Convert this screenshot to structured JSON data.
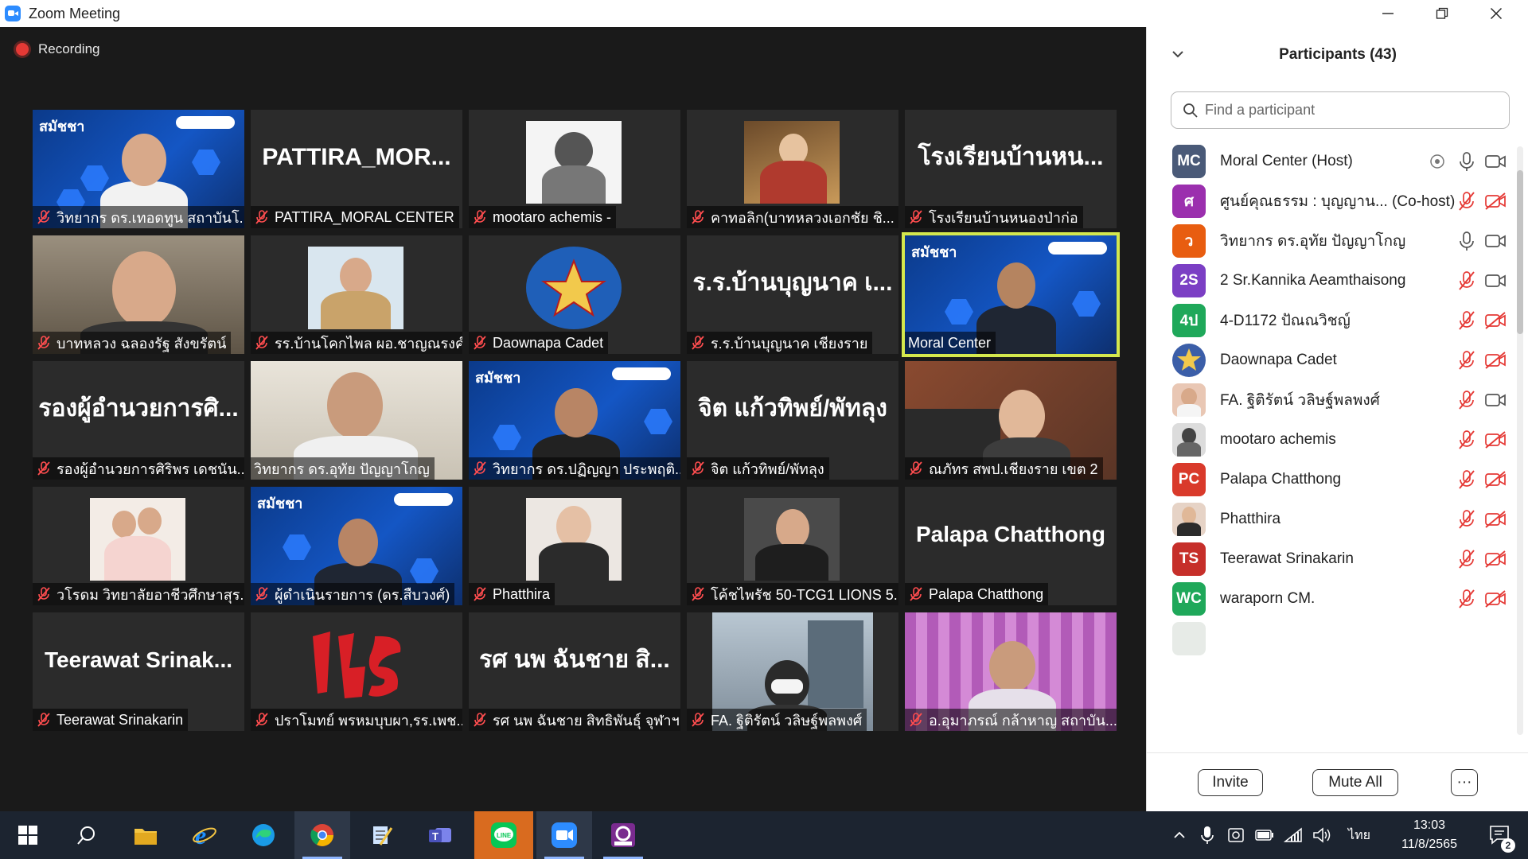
{
  "window": {
    "title": "Zoom Meeting",
    "controls": [
      "minimize",
      "restore",
      "close"
    ]
  },
  "meeting": {
    "recording_label": "Recording"
  },
  "gallery": {
    "tiles": [
      {
        "label": "วิทยากร ดร.เทอดทูน สถาบันโ...",
        "big_text": ""
      },
      {
        "label": "PATTIRA_MORAL CENTER",
        "big_text": "PATTIRA_MOR..."
      },
      {
        "label": "mootaro achemis -",
        "big_text": ""
      },
      {
        "label": "คาทอลิก(บาทหลวงเอกชัย ชิ...",
        "big_text": ""
      },
      {
        "label": "โรงเรียนบ้านหนองป่าก่อ",
        "big_text": "โรงเรียนบ้านหน..."
      },
      {
        "label": "บาทหลวง ฉลองรัฐ สังขรัตน์",
        "big_text": ""
      },
      {
        "label": "รร.บ้านโคกไพล ผอ.ชาญณรงค์",
        "big_text": ""
      },
      {
        "label": "Daownapa Cadet",
        "big_text": ""
      },
      {
        "label": "ร.ร.บ้านบุญนาค เชียงราย",
        "big_text": "ร.ร.บ้านบุญนาค เ..."
      },
      {
        "label": "Moral Center",
        "big_text": ""
      },
      {
        "label": "รองผู้อำนวยการศิริพร เดชนัน...",
        "big_text": "รองผู้อำนวยการศิ..."
      },
      {
        "label": "วิทยากร ดร.อุทัย ปัญญาโกญ",
        "big_text": ""
      },
      {
        "label": "วิทยากร ดร.ปฏิญญา ประพฤติ...",
        "big_text": ""
      },
      {
        "label": "จิต แก้วทิพย์/พัทลุง",
        "big_text": "จิต แก้วทิพย์/พัทลุง"
      },
      {
        "label": "ณภัทร สพป.เชียงราย เขต 2",
        "big_text": ""
      },
      {
        "label": "วโรดม วิทยาลัยอาชีวศึกษาสุร...",
        "big_text": ""
      },
      {
        "label": "ผู้ดำเนินรายการ (ดร.สืบวงศ์)",
        "big_text": ""
      },
      {
        "label": "Phatthira",
        "big_text": ""
      },
      {
        "label": "โค้ชไพรัช 50-TCG1 LIONS 5...",
        "big_text": ""
      },
      {
        "label": "Palapa Chatthong",
        "big_text": "Palapa Chatthong"
      },
      {
        "label": "Teerawat Srinakarin",
        "big_text": "Teerawat  Srinak..."
      },
      {
        "label": "ปราโมทย์ พรหมบุบผา,รร.เพช...",
        "big_text": ""
      },
      {
        "label": "รศ นพ ฉันชาย สิทธิพันธุ์ จุฬาฯ",
        "big_text": "รศ นพ ฉันชาย สิ..."
      },
      {
        "label": "FA. ฐิติรัตน์ วลิษฐ์พลพงศ์",
        "big_text": ""
      },
      {
        "label": "อ.อุมาภรณ์ กล้าหาญ สถาบัน...",
        "big_text": ""
      }
    ],
    "banner_logo": "สมัชชา"
  },
  "participants": {
    "title": "Participants (43)",
    "search_placeholder": "Find a participant",
    "list": [
      {
        "initials": "MC",
        "name": "Moral Center (Host)",
        "color": "#4a5a78",
        "mic": "on",
        "cam": "on"
      },
      {
        "initials": "ศ",
        "name": "ศูนย์คุณธรรม : บุญญาน... (Co-host)",
        "color": "#9b2fae",
        "mic": "muted",
        "cam": "off"
      },
      {
        "initials": "ว",
        "name": "วิทยากร ดร.อุทัย ปัญญาโกญ",
        "color": "#e85d10",
        "mic": "on",
        "cam": "on"
      },
      {
        "initials": "2S",
        "name": "2 Sr.Kannika Aeamthaisong",
        "color": "#7b3fc4",
        "mic": "muted",
        "cam": "on"
      },
      {
        "initials": "4ป",
        "name": "4-D1172 ปัณณวิชญ์",
        "color": "#1fa85a",
        "mic": "muted",
        "cam": "off"
      },
      {
        "initials": "",
        "name": "Daownapa Cadet",
        "color": "#3b5ea8",
        "mic": "muted",
        "cam": "off"
      },
      {
        "initials": "",
        "name": "FA. ฐิติรัตน์ วลิษฐ์พลพงศ์",
        "color": "#e9c7b4",
        "mic": "muted",
        "cam": "on"
      },
      {
        "initials": "",
        "name": "mootaro achemis",
        "color": "#dcdcdc",
        "mic": "muted",
        "cam": "off"
      },
      {
        "initials": "PC",
        "name": "Palapa Chatthong",
        "color": "#d93a2b",
        "mic": "muted",
        "cam": "off"
      },
      {
        "initials": "",
        "name": "Phatthira",
        "color": "#e6d3c6",
        "mic": "muted",
        "cam": "off"
      },
      {
        "initials": "TS",
        "name": "Teerawat Srinakarin",
        "color": "#c62f2a",
        "mic": "muted",
        "cam": "off"
      },
      {
        "initials": "WC",
        "name": "waraporn CM.",
        "color": "#1fa85a",
        "mic": "muted",
        "cam": "off"
      }
    ],
    "invite_label": "Invite",
    "mute_all_label": "Mute All",
    "more_label": "···"
  },
  "taskbar": {
    "apps": [
      "start",
      "search",
      "file-explorer",
      "internet-explorer",
      "edge",
      "chrome",
      "notepad",
      "teams",
      "line",
      "zoom",
      "pdf"
    ],
    "language": "ไทย",
    "time": "13:03",
    "date": "11/8/2565",
    "notification_count": "2"
  }
}
